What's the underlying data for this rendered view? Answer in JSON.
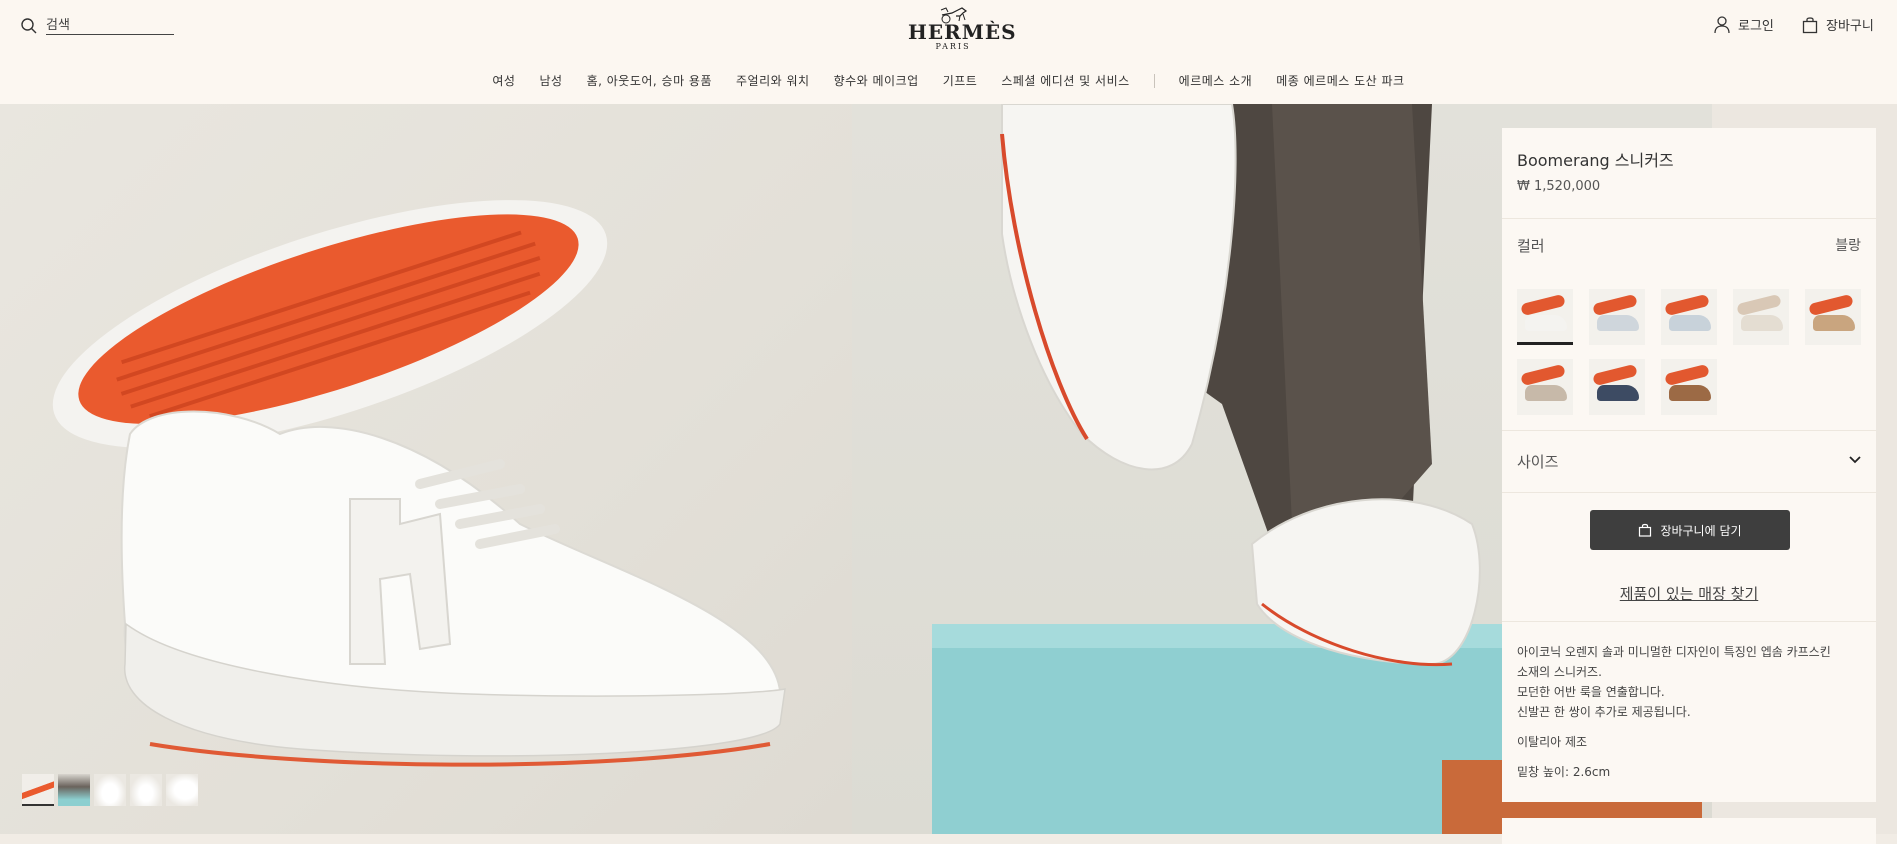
{
  "header": {
    "search_placeholder": "검색",
    "logo": {
      "brand": "HERMÈS",
      "city": "PARIS"
    },
    "login_label": "로그인",
    "cart_label": "장바구니"
  },
  "nav": {
    "items": [
      "여성",
      "남성",
      "홈, 아웃도어, 승마 용품",
      "주얼리와 워치",
      "향수와 메이크업",
      "기프트",
      "스페셜 에디션 및 서비스"
    ],
    "secondary_items": [
      "에르메스 소개",
      "메종 에르메스 도산 파크"
    ]
  },
  "gallery": {
    "thumbnail_count": 5,
    "active_index": 0
  },
  "product": {
    "title": "Boomerang 스니커즈",
    "price": "₩ 1,520,000",
    "color_label": "컬러",
    "color_value": "블랑",
    "swatches": [
      {
        "name": "white-orange",
        "sole": "#e2582f",
        "body": "#f4f3f0",
        "selected": true
      },
      {
        "name": "white-navy",
        "sole": "#e2582f",
        "body": "#cfd6dc",
        "selected": false
      },
      {
        "name": "white-blue",
        "sole": "#e2582f",
        "body": "#c8d2da",
        "selected": false
      },
      {
        "name": "beige",
        "sole": "#d9c8b6",
        "body": "#e4ddd2",
        "selected": false
      },
      {
        "name": "camel",
        "sole": "#e2582f",
        "body": "#c9a57f",
        "selected": false
      },
      {
        "name": "grey-tan",
        "sole": "#e2582f",
        "body": "#c7b9a9",
        "selected": false
      },
      {
        "name": "navy-white",
        "sole": "#e2582f",
        "body": "#3d4b63",
        "selected": false
      },
      {
        "name": "brown",
        "sole": "#e2582f",
        "body": "#9c6a45",
        "selected": false
      }
    ],
    "size_label": "사이즈",
    "add_to_cart": "장바구니에 담기",
    "find_store": "제품이 있는 매장 찾기",
    "description": [
      "아이코닉 오렌지 솔과 미니멀한 디자인이 특징인 엡솜 카프스킨",
      "소재의 스니커즈.",
      "모던한 어반 룩을 연출합니다.",
      "신발끈 한 쌍이 추가로 제공됩니다."
    ],
    "made_in": "이탈리아 제조",
    "sole_height": "밑창 높이: 2.6cm"
  },
  "colors": {
    "background": "#fcf7f1",
    "button": "#3e3e3e",
    "accent_orange": "#e2582f"
  }
}
